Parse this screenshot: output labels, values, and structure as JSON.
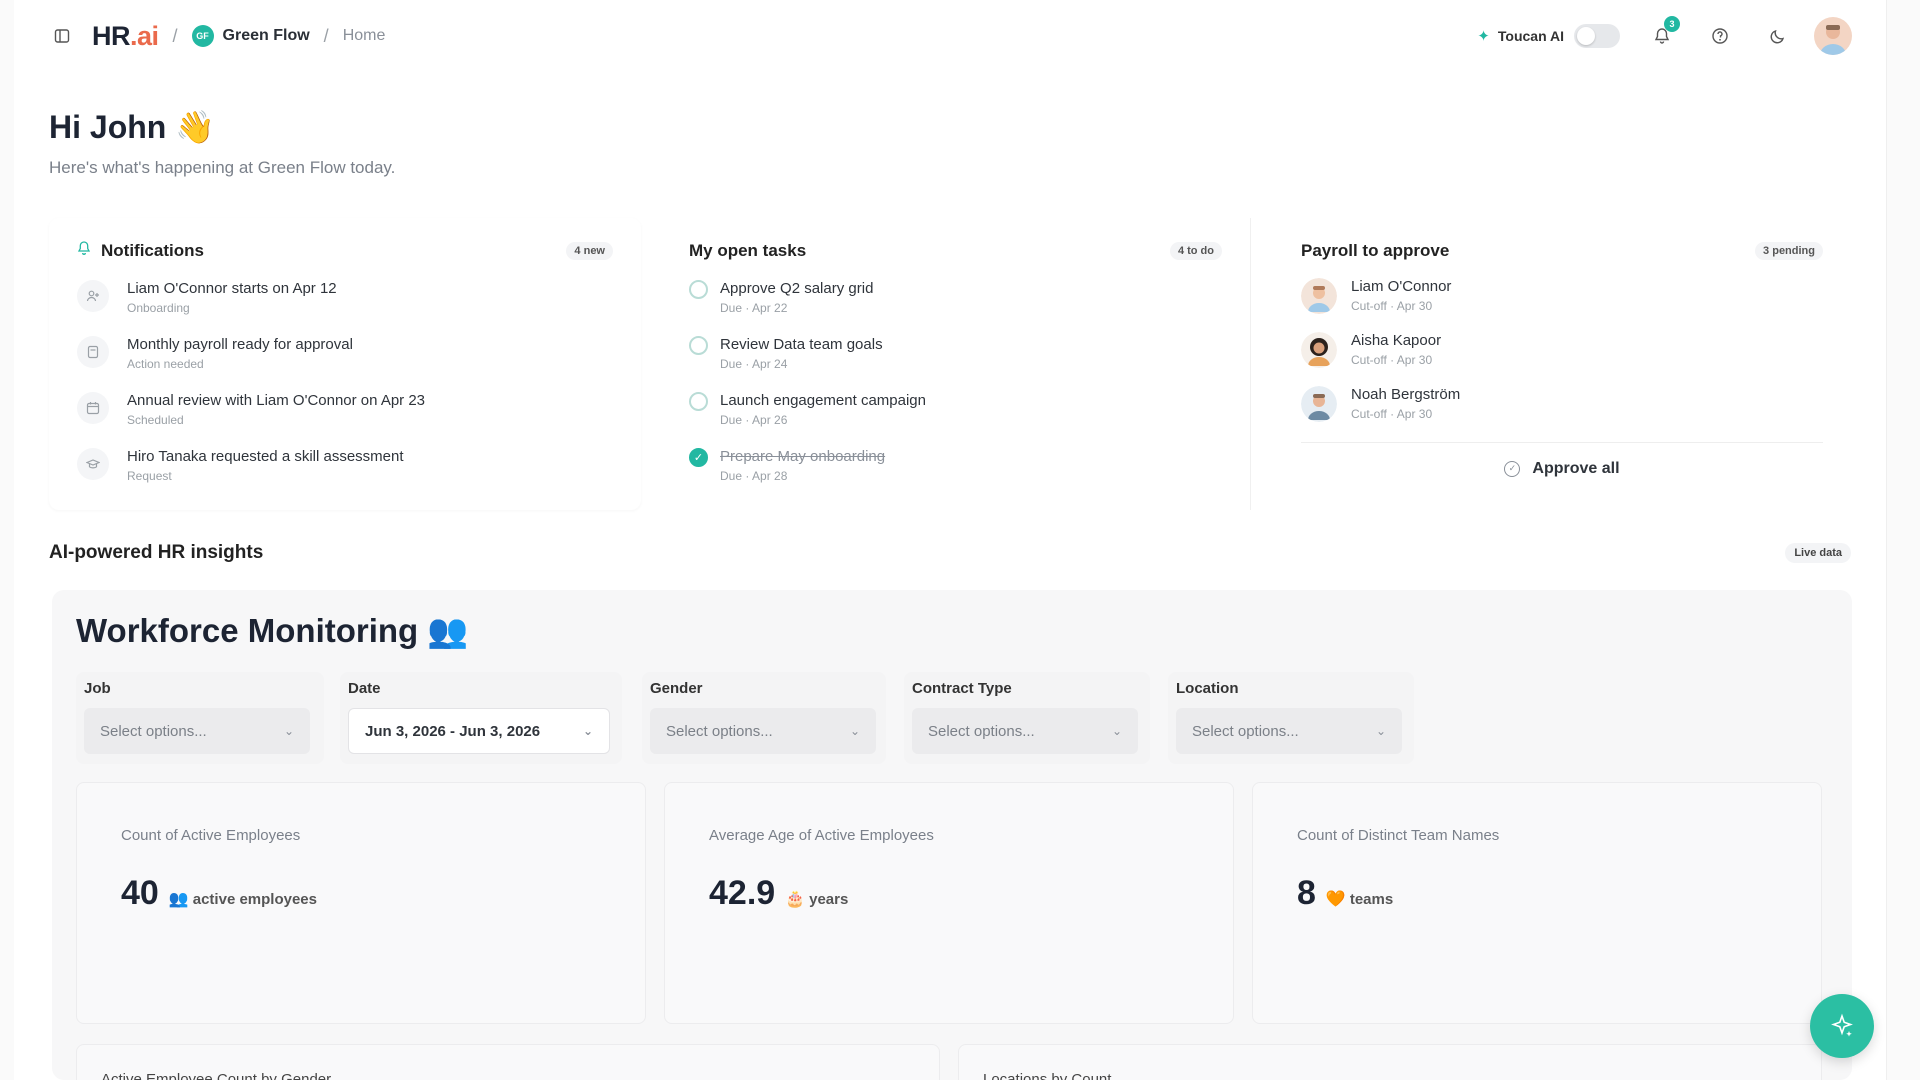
{
  "header": {
    "brand_main": "HR",
    "brand_suffix": ".ai",
    "separator": "/",
    "org_initials": "GF",
    "org_name": "Green Flow",
    "page": "Home",
    "ai_label": "Toucan AI",
    "notification_count": "3"
  },
  "greeting": {
    "title": "Hi John 👋",
    "subtitle": "Here's what's happening at Green Flow today."
  },
  "notifications": {
    "title": "Notifications",
    "badge": "4 new",
    "items": [
      {
        "text": "Liam O'Connor starts on Apr 12",
        "sub": "Onboarding",
        "icon": "user-plus-icon"
      },
      {
        "text": "Monthly payroll ready for approval",
        "sub": "Action needed",
        "icon": "file-icon"
      },
      {
        "text": "Annual review with Liam O'Connor on Apr 23",
        "sub": "Scheduled",
        "icon": "calendar-icon"
      },
      {
        "text": "Hiro Tanaka requested a skill assessment",
        "sub": "Request",
        "icon": "graduation-cap-icon"
      }
    ]
  },
  "tasks": {
    "title": "My open tasks",
    "badge": "4 to do",
    "items": [
      {
        "text": "Approve Q2 salary grid",
        "sub": "Due · Apr 22",
        "done": false
      },
      {
        "text": "Review Data team goals",
        "sub": "Due · Apr 24",
        "done": false
      },
      {
        "text": "Launch engagement campaign",
        "sub": "Due · Apr 26",
        "done": false
      },
      {
        "text": "Prepare May onboarding",
        "sub": "Due · Apr 28",
        "done": true
      }
    ]
  },
  "payroll": {
    "title": "Payroll to approve",
    "badge": "3 pending",
    "items": [
      {
        "name": "Liam O'Connor",
        "sub": "Cut-off · Apr 30"
      },
      {
        "name": "Aisha Kapoor",
        "sub": "Cut-off · Apr 30"
      },
      {
        "name": "Noah Bergström",
        "sub": "Cut-off · Apr 30"
      }
    ],
    "approve_all": "Approve all"
  },
  "insights": {
    "title": "AI-powered HR insights",
    "badge": "Live data",
    "panel_title": "Workforce Monitoring 👥",
    "filters": [
      {
        "label": "Job",
        "value": "Select options..."
      },
      {
        "label": "Date",
        "value": "Jun 3, 2026 - Jun 3, 2026"
      },
      {
        "label": "Gender",
        "value": "Select options..."
      },
      {
        "label": "Contract Type",
        "value": "Select options..."
      },
      {
        "label": "Location",
        "value": "Select options..."
      }
    ],
    "kpis": [
      {
        "label": "Count of Active Employees",
        "value": "40",
        "emoji": "👥",
        "unit": "active employees"
      },
      {
        "label": "Average Age of Active Employees",
        "value": "42.9",
        "emoji": "🎂",
        "unit": "years"
      },
      {
        "label": "Count of Distinct Team Names",
        "value": "8",
        "emoji": "🧡",
        "unit": "teams"
      }
    ],
    "charts": [
      "Active Employee Count by Gender",
      "Locations by Count"
    ]
  },
  "colors": {
    "accent": "#22b8a2",
    "brand_ai": "#ea6a4c"
  }
}
